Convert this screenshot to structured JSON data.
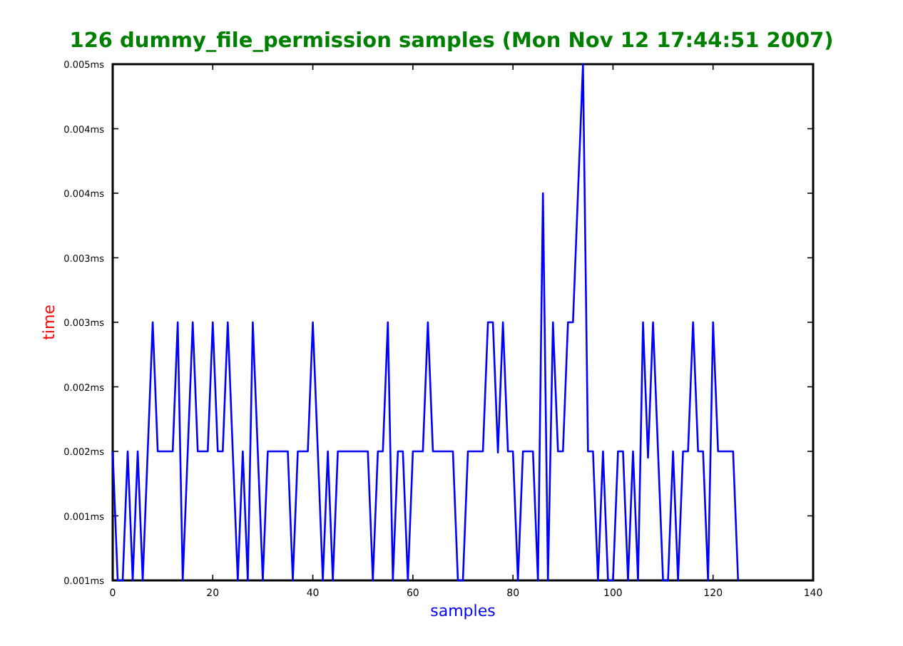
{
  "chart_data": {
    "type": "line",
    "title": "126 dummy_file_permission samples (Mon Nov 12 17:44:51 2007)",
    "xlabel": "samples",
    "ylabel": "time",
    "x": [
      0,
      1,
      2,
      3,
      4,
      5,
      6,
      7,
      8,
      9,
      10,
      11,
      12,
      13,
      14,
      15,
      16,
      17,
      18,
      19,
      20,
      21,
      22,
      23,
      24,
      25,
      26,
      27,
      28,
      29,
      30,
      31,
      32,
      33,
      34,
      35,
      36,
      37,
      38,
      39,
      40,
      41,
      42,
      43,
      44,
      45,
      46,
      47,
      48,
      49,
      50,
      51,
      52,
      53,
      54,
      55,
      56,
      57,
      58,
      59,
      60,
      61,
      62,
      63,
      64,
      65,
      66,
      67,
      68,
      69,
      70,
      71,
      72,
      73,
      74,
      75,
      76,
      77,
      78,
      79,
      80,
      81,
      82,
      83,
      84,
      85,
      86,
      87,
      88,
      89,
      90,
      91,
      92,
      93,
      94,
      95,
      96,
      97,
      98,
      99,
      100,
      101,
      102,
      103,
      104,
      105,
      106,
      107,
      108,
      109,
      110,
      111,
      112,
      113,
      114,
      115,
      116,
      117,
      118,
      119,
      120,
      121,
      122,
      123,
      124,
      125
    ],
    "series": [
      {
        "color": "#0000ff",
        "values": [
          0.002,
          0.001,
          0.001,
          0.002,
          0.001,
          0.002,
          0.001,
          0.002,
          0.003,
          0.002,
          0.002,
          0.002,
          0.002,
          0.003,
          0.001,
          0.002,
          0.003,
          0.002,
          0.002,
          0.002,
          0.003,
          0.002,
          0.002,
          0.003,
          0.002,
          0.001,
          0.002,
          0.001,
          0.003,
          0.002,
          0.001,
          0.002,
          0.002,
          0.002,
          0.002,
          0.002,
          0.001,
          0.002,
          0.002,
          0.002,
          0.003,
          0.002,
          0.001,
          0.002,
          0.001,
          0.002,
          0.002,
          0.002,
          0.002,
          0.002,
          0.002,
          0.002,
          0.001,
          0.002,
          0.002,
          0.003,
          0.001,
          0.002,
          0.002,
          0.001,
          0.002,
          0.002,
          0.002,
          0.003,
          0.002,
          0.002,
          0.002,
          0.002,
          0.002,
          0.001,
          0.001,
          0.002,
          0.002,
          0.002,
          0.002,
          0.003,
          0.003,
          0.00199,
          0.003,
          0.002,
          0.002,
          0.001,
          0.002,
          0.002,
          0.002,
          0.001,
          0.004,
          0.001,
          0.003,
          0.002,
          0.002,
          0.003,
          0.003,
          0.004,
          0.005,
          0.002,
          0.002,
          0.001,
          0.002,
          0.001,
          0.001,
          0.002,
          0.002,
          0.001,
          0.002,
          0.001,
          0.003,
          0.00195,
          0.003,
          0.002,
          0.001,
          0.001,
          0.002,
          0.001,
          0.002,
          0.002,
          0.003,
          0.002,
          0.002,
          0.001,
          0.003,
          0.002,
          0.002,
          0.002,
          0.002,
          0.001
        ]
      }
    ],
    "xlim": [
      0,
      140
    ],
    "ylim": [
      0.001,
      0.005
    ],
    "xticks": [
      0,
      20,
      40,
      60,
      80,
      100,
      120,
      140
    ],
    "yticks": [
      {
        "value": 0.001,
        "label": "0.001ms"
      },
      {
        "value": 0.0015,
        "label": "0.001ms"
      },
      {
        "value": 0.002,
        "label": "0.002ms"
      },
      {
        "value": 0.0025,
        "label": "0.002ms"
      },
      {
        "value": 0.003,
        "label": "0.003ms"
      },
      {
        "value": 0.0035,
        "label": "0.003ms"
      },
      {
        "value": 0.004,
        "label": "0.004ms"
      },
      {
        "value": 0.0045,
        "label": "0.004ms"
      },
      {
        "value": 0.005,
        "label": "0.005ms"
      }
    ]
  }
}
